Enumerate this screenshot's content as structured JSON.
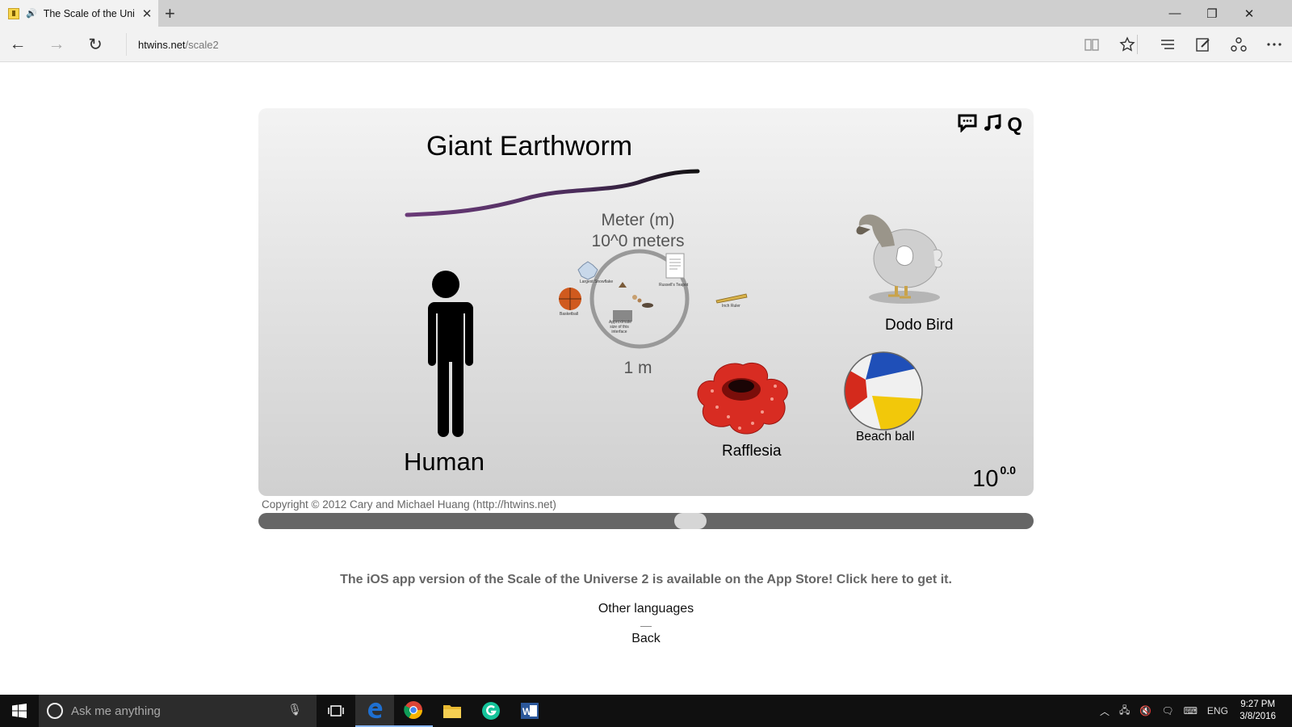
{
  "browser": {
    "tab_title": "The Scale of the Uni",
    "tab_close": "✕",
    "new_tab": "+",
    "minimize": "—",
    "restore": "❐",
    "close": "✕",
    "back_glyph": "←",
    "forward_glyph": "→",
    "refresh_glyph": "↻",
    "url_host": "htwins.net",
    "url_path": "/scale2",
    "icons": [
      "reading-view-icon",
      "favorite-star-icon",
      "hub-icon",
      "web-note-icon",
      "share-icon",
      "more-icon"
    ]
  },
  "scale": {
    "controls": [
      "speech-bubble-icon",
      "music-note-icon",
      "quality-q-icon"
    ],
    "quality_label": "Q",
    "giant_earthworm": "Giant Earthworm",
    "unit_name": "Meter (m)",
    "unit_power": "10^0 meters",
    "ring_label": "1 m",
    "human": "Human",
    "dodo": "Dodo Bird",
    "beach_ball": "Beach ball",
    "rafflesia": "Rafflesia",
    "tiny_labels": {
      "basketball": "Basketball",
      "russells_teapot": "Russell's Teapot",
      "inch_ruler": "Inch Ruler",
      "approx_size": "Approximate size of this interface",
      "largest_snowflake": "Largest Snowflake"
    },
    "exponent_base": "10",
    "exponent_value": "0.0",
    "slider_position_fraction": 0.56
  },
  "page": {
    "copyright": "Copyright © 2012 Cary and Michael Huang (http://htwins.net)",
    "promo": "The iOS app version of the Scale of the Universe 2 is available on the App Store! Click here to get it.",
    "other_languages": "Other languages",
    "back": "Back"
  },
  "taskbar": {
    "search_placeholder": "Ask me anything",
    "apps": [
      "task-view-icon",
      "edge-icon",
      "chrome-icon",
      "file-explorer-icon",
      "grammarly-icon",
      "word-icon"
    ],
    "tray_language": "ENG",
    "time": "9:27 PM",
    "date": "3/8/2016"
  },
  "colors": {
    "stage_top": "#f3f3f3",
    "stage_bottom": "#d0d0d0",
    "slider_track": "#666666",
    "taskbar": "#101010",
    "edge_blue": "#1e6fd0"
  }
}
